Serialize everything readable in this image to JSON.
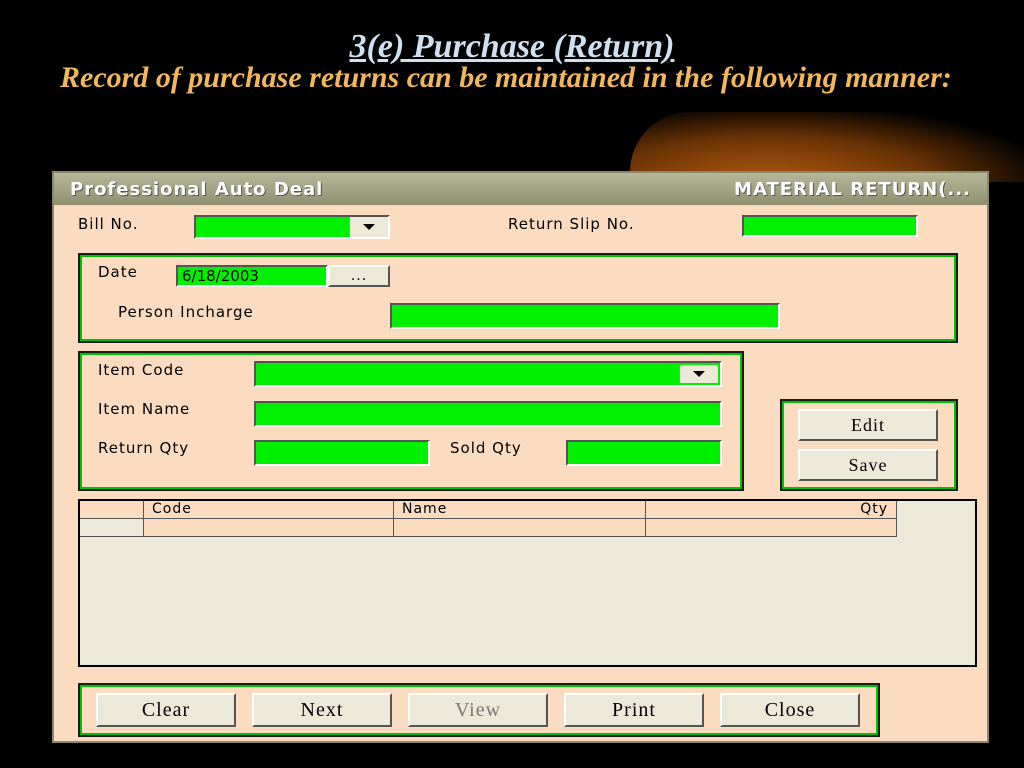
{
  "slide": {
    "title": "3(e) Purchase (Return)",
    "text": "Record of purchase returns can be maintained in the following manner:"
  },
  "window": {
    "title_left": "Professional Auto Deal",
    "title_right": "MATERIAL  RETURN(..."
  },
  "form": {
    "bill_no_label": "Bill No.",
    "bill_no_value": "",
    "return_slip_label": "Return Slip No.",
    "return_slip_value": "",
    "date_label": "Date",
    "date_value": "6/18/2003",
    "date_button": "...",
    "person_label": "Person Incharge",
    "person_value": "",
    "item_code_label": "Item Code",
    "item_code_value": "",
    "item_name_label": "Item Name",
    "item_name_value": "",
    "return_qty_label": "Return Qty",
    "return_qty_value": "",
    "sold_qty_label": "Sold Qty",
    "sold_qty_value": ""
  },
  "side_buttons": {
    "edit": "Edit",
    "save": "Save"
  },
  "grid": {
    "columns": [
      "Code",
      "Name",
      "Qty"
    ],
    "rows": []
  },
  "bottom_buttons": {
    "clear": "Clear",
    "next": "Next",
    "view": "View",
    "print": "Print",
    "close": "Close"
  },
  "colors": {
    "field_bg": "#00f000",
    "window_bg": "#fcdcc0",
    "button_bg": "#ece9d8",
    "slide_text": "#f2b75a"
  }
}
